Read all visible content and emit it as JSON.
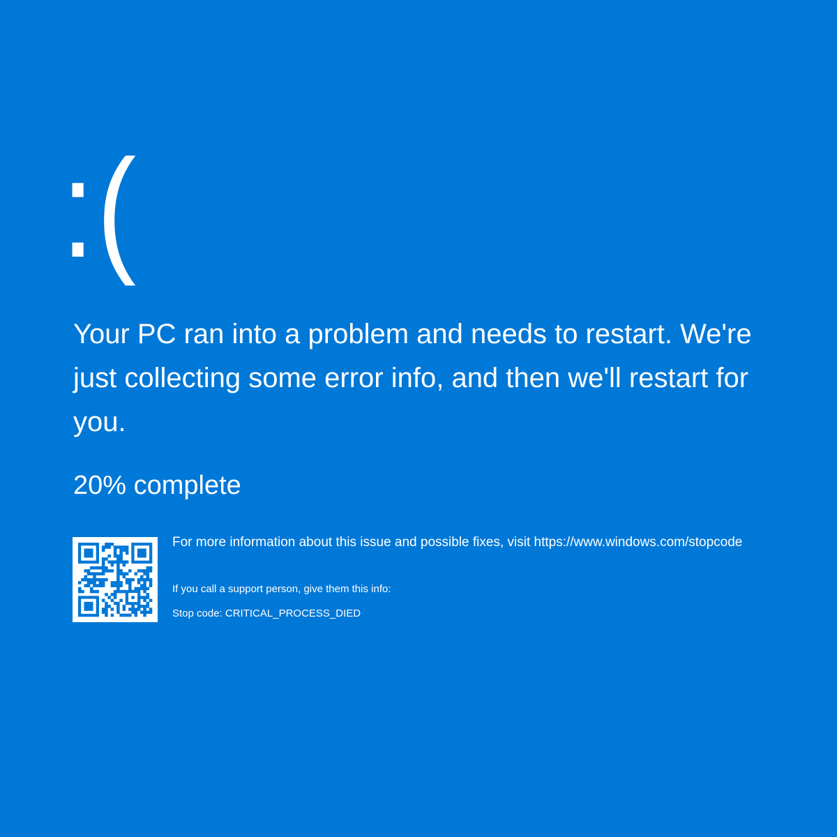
{
  "screen": {
    "background_color": "#0078d7",
    "text_color": "#ffffff"
  },
  "sad_face": ":(",
  "message": "Your PC ran into a problem and needs to restart. We're just collecting some error info, and then we'll restart for you.",
  "progress": {
    "percent": 20,
    "text": "20% complete"
  },
  "qr_code": {
    "icon": "qr-code-icon"
  },
  "info": {
    "more_info_prefix": "For more information about this issue and possible fixes, visit ",
    "url": "https://www.windows.com/stopcode",
    "support_text": "If you call a support person, give them this info:",
    "stop_code_text": "Stop code: CRITICAL_PROCESS_DIED"
  }
}
